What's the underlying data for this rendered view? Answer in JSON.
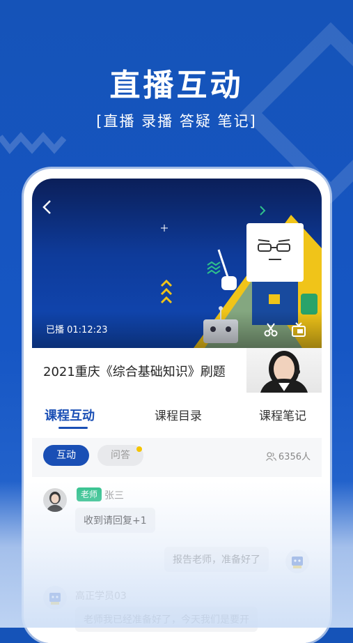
{
  "promo": {
    "headline": "直播互动",
    "subline": "[直播 录播 答疑 笔记]"
  },
  "video": {
    "replay_time": "已播 01:12:23"
  },
  "course": {
    "title": "2021重庆《综合基础知识》刷题"
  },
  "tabs": [
    {
      "label": "课程互动"
    },
    {
      "label": "课程目录"
    },
    {
      "label": "课程笔记"
    }
  ],
  "filter": {
    "interact_label": "互动",
    "qa_label": "问答",
    "online_count": "6356人"
  },
  "messages": [
    {
      "role": "老师",
      "name": "张三",
      "text": "收到请回复+1"
    },
    {
      "text": "报告老师，准备好了"
    },
    {
      "name": "高正学员03",
      "text": "老师我已经准备好了，今天我们是要开"
    }
  ],
  "colors": {
    "brand_blue": "#1553b8",
    "accent_blue": "#1a4fb5",
    "teacher_tag": "#2fc08b",
    "notify_dot": "#f5c400"
  }
}
